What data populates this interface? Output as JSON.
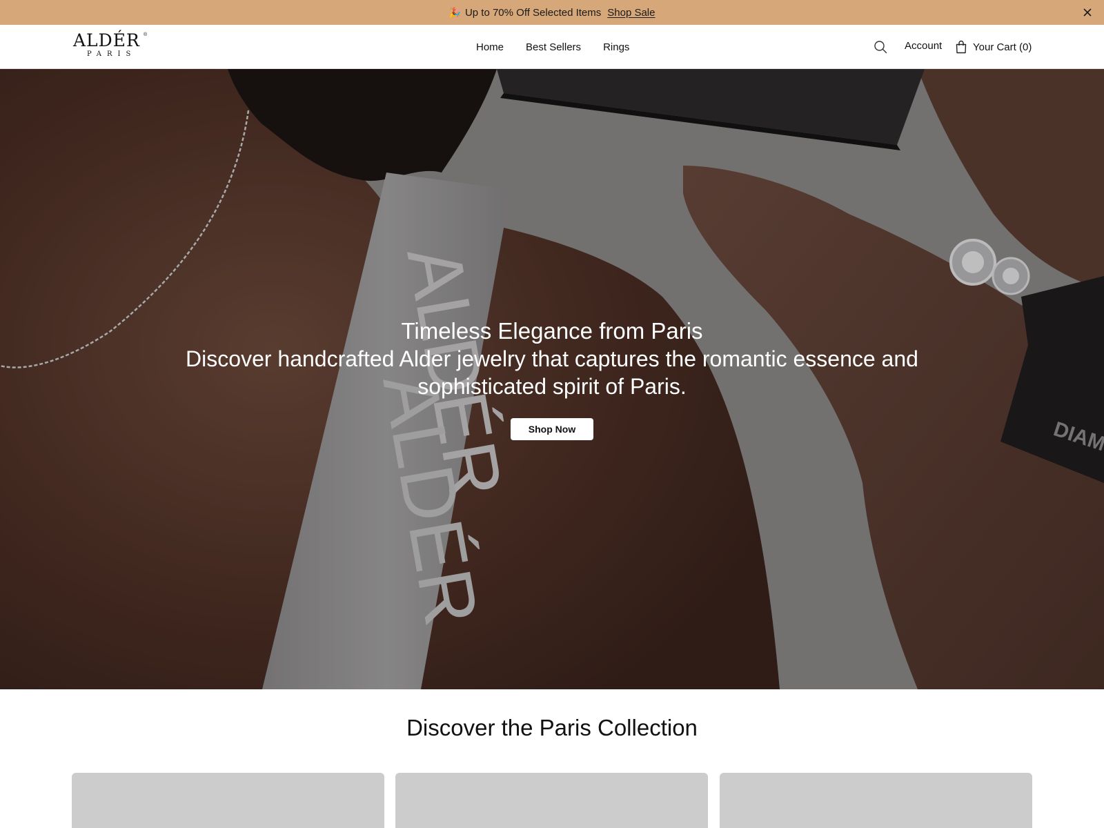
{
  "announcement": {
    "emoji": "🎉",
    "text": "Up to 70% Off Selected Items",
    "link_label": "Shop Sale"
  },
  "header": {
    "logo": {
      "wordmark": "ALDÉR",
      "registered": "®",
      "sub": "PARIS"
    },
    "nav": [
      "Home",
      "Best Sellers",
      "Rings"
    ],
    "account_label": "Account",
    "cart_label": "Your Cart (0)"
  },
  "hero": {
    "title": "Timeless Elegance from Paris",
    "subtitle": "Discover handcrafted Alder jewelry that captures the romantic essence and sophisticated spirit of Paris.",
    "cta_label": "Shop Now",
    "ribbon_text": "ALDÉR",
    "box_text": "DIAMO"
  },
  "collection": {
    "title": "Discover the Paris Collection",
    "cards": 3
  },
  "colors": {
    "announcement_bg": "#d6a778",
    "card_placeholder": "#cccccc"
  }
}
